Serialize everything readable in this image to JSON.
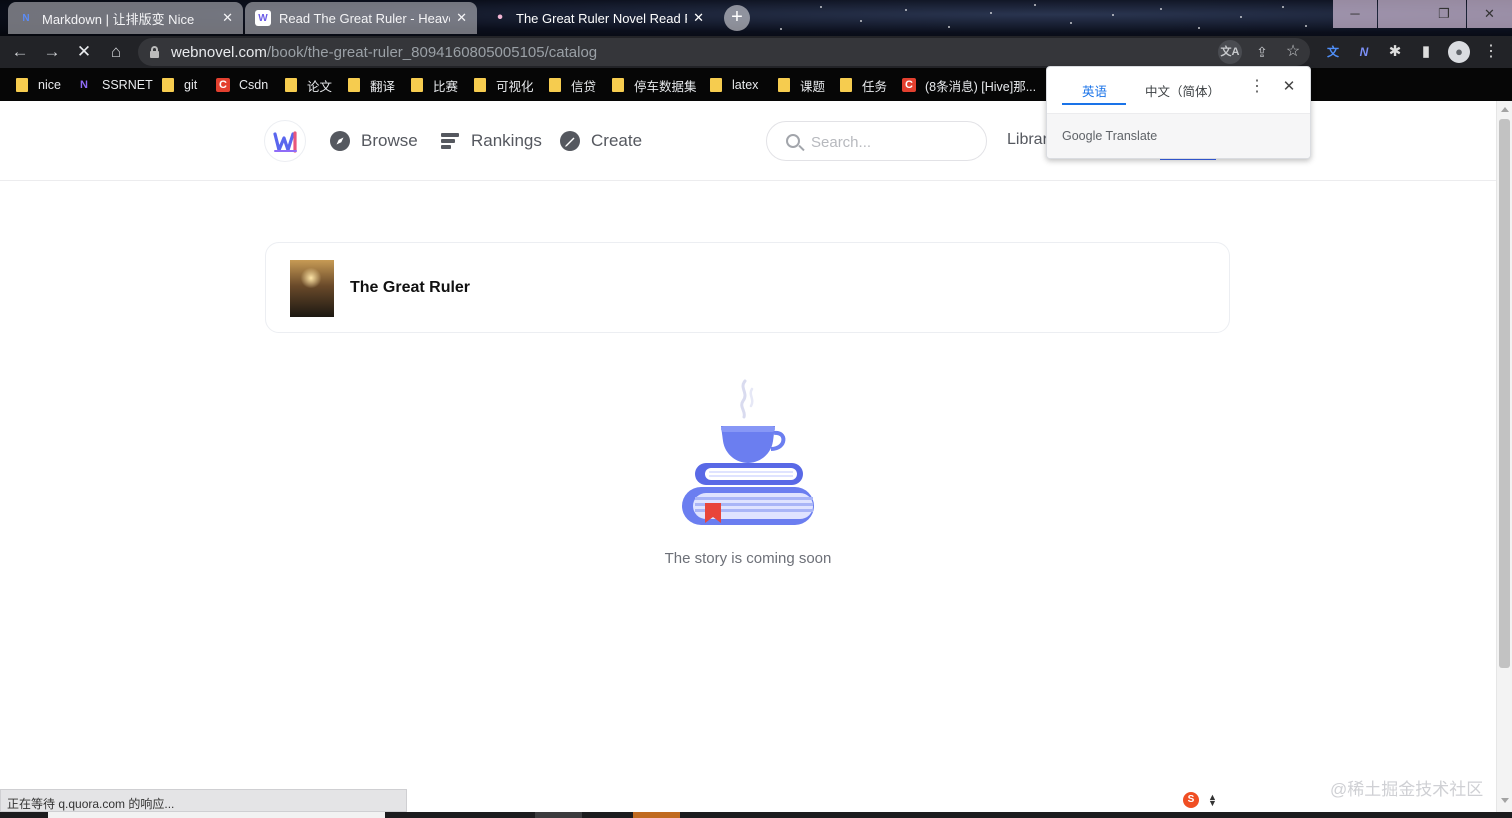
{
  "browser": {
    "tabs": [
      {
        "title": "Markdown | 让排版变 Nice",
        "close": "✕",
        "state": "inactive",
        "favicon": "N"
      },
      {
        "title": "Read The Great Ruler - Heave",
        "close": "✕",
        "state": "inactive",
        "favicon": "W"
      },
      {
        "title": "The Great Ruler Novel Read F",
        "close": "✕",
        "state": "active",
        "favicon": "•"
      }
    ],
    "new_tab": "+",
    "address_host": "webnovel.com",
    "address_path": "/book/the-great-ruler_8094160805005105/catalog",
    "translate_icon": "文A",
    "bookmarks": [
      {
        "label": "nice",
        "icon": "folder"
      },
      {
        "label": "SSRNET",
        "icon": "ssrnet"
      },
      {
        "label": "git",
        "icon": "folder"
      },
      {
        "label": "Csdn",
        "icon": "csdn"
      },
      {
        "label": "论文",
        "icon": "folder"
      },
      {
        "label": "翻译",
        "icon": "folder"
      },
      {
        "label": "比赛",
        "icon": "folder"
      },
      {
        "label": "可视化",
        "icon": "folder"
      },
      {
        "label": "信贷",
        "icon": "folder"
      },
      {
        "label": "停车数据集",
        "icon": "folder"
      },
      {
        "label": "latex",
        "icon": "folder"
      },
      {
        "label": "课题",
        "icon": "folder"
      },
      {
        "label": "任务",
        "icon": "folder"
      },
      {
        "label": "(8条消息) [Hive]那...",
        "icon": "csdn"
      }
    ],
    "csdn_letter": "C",
    "ssrnet_letter": "N",
    "status_text": "正在等待 q.quora.com 的响应..."
  },
  "translate_popup": {
    "source_lang": "英语",
    "target_lang": "中文（简体）",
    "brand": "Google Translate",
    "close": "✕",
    "more": "⋮"
  },
  "site": {
    "nav": [
      {
        "label": "Browse",
        "icon": "compass-icon"
      },
      {
        "label": "Rankings",
        "icon": "rankings-icon"
      },
      {
        "label": "Create",
        "icon": "pen-icon"
      }
    ],
    "search_placeholder": "Search...",
    "library_label": "Librar",
    "book_title": "The Great Ruler",
    "empty_message": "The story is coming soon"
  },
  "watermark": "@稀土掘金技术社区",
  "float_icon_letter": "S",
  "colors": {
    "brand_blue": "#3b66f5",
    "translate_blue": "#1a73e8",
    "illustration_blue": "#6b7ef0",
    "bookmark_folder": "#f6cc4f",
    "csdn_red": "#e3402f"
  }
}
